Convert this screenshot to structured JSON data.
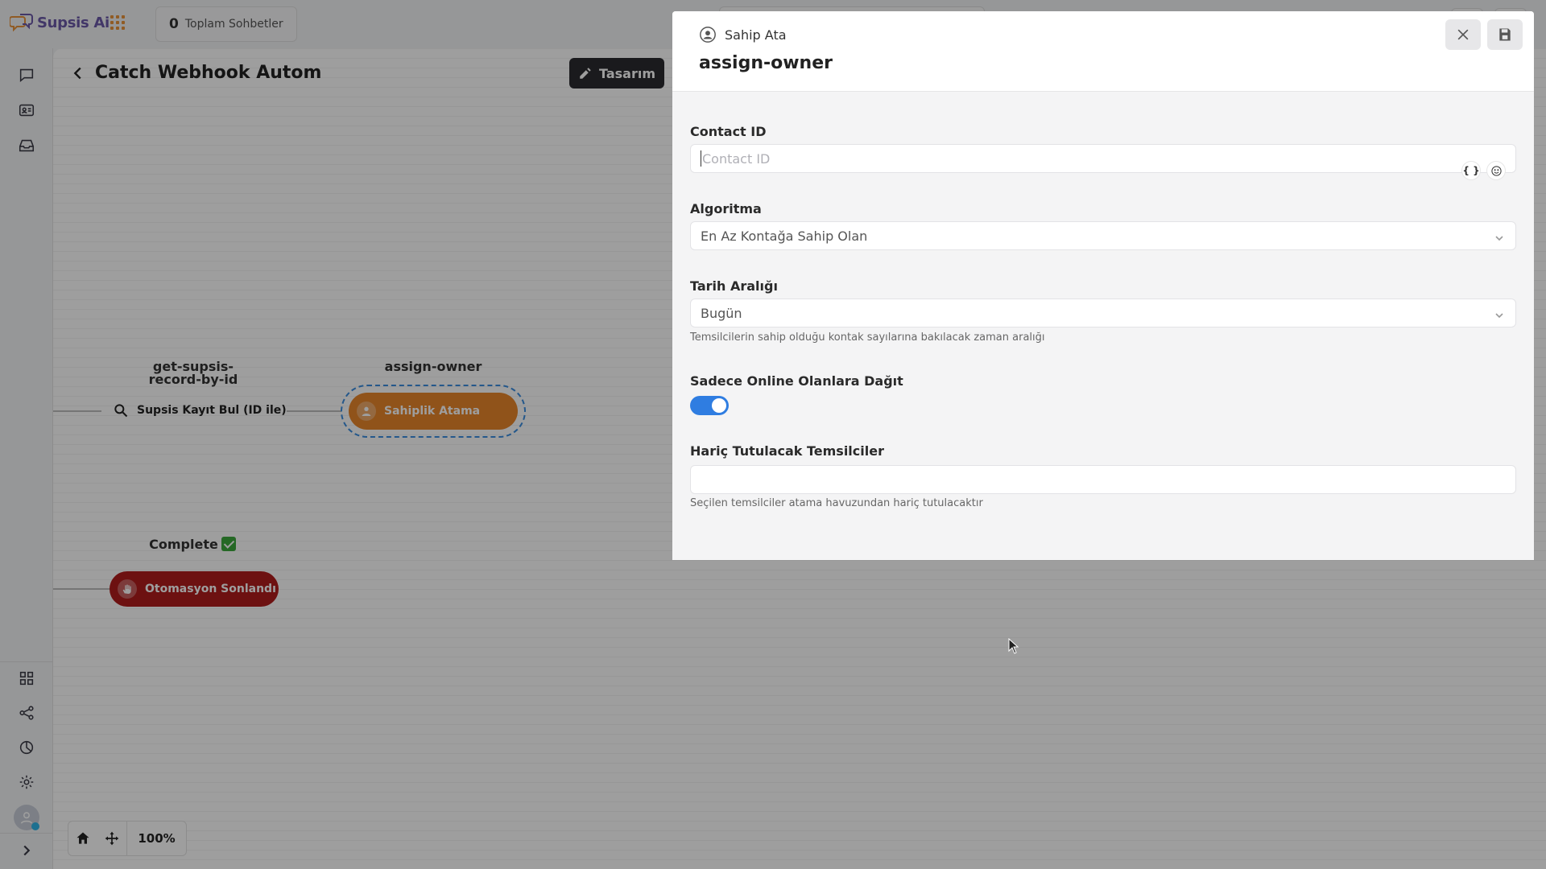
{
  "app": {
    "brand": "Supsis Ai"
  },
  "topbar": {
    "chat_count": "0",
    "chat_count_label": "Toplam Sohbetler"
  },
  "canvas": {
    "title": "Catch Webhook Automa",
    "design_button": "Tasarım",
    "nodes": {
      "get_record": {
        "label": "get-supsis-record-by-id",
        "action": "Supsis Kayıt Bul (ID ile)"
      },
      "assign_owner": {
        "label": "assign-owner",
        "action": "Sahiplik Atama"
      },
      "complete": {
        "label": "Complete",
        "action": "Otomasyon Sonlandı"
      }
    },
    "zoom": "100%"
  },
  "drawer": {
    "subtitle": "Sahip Ata",
    "title": "assign-owner",
    "fields": {
      "contact_id": {
        "label": "Contact ID",
        "placeholder": "Contact ID",
        "value": ""
      },
      "algorithm": {
        "label": "Algoritma",
        "value": "En Az Kontağa Sahip Olan"
      },
      "date_range": {
        "label": "Tarih Aralığı",
        "value": "Bugün",
        "help": "Temsilcilerin sahip olduğu kontak sayılarına bakılacak zaman aralığı"
      },
      "online_only": {
        "label": "Sadece Online Olanlara Dağıt",
        "enabled": true
      },
      "excluded": {
        "label": "Hariç Tutulacak Temsilciler",
        "value": "",
        "help": "Seçilen temsilciler atama havuzundan hariç tutulacaktır"
      }
    },
    "variable_icon_text": "{ }"
  },
  "colors": {
    "accent": "#2f7de1",
    "node_orange": "#e8862a",
    "node_red": "#b01c1c",
    "brand": "#6b5aa8"
  }
}
